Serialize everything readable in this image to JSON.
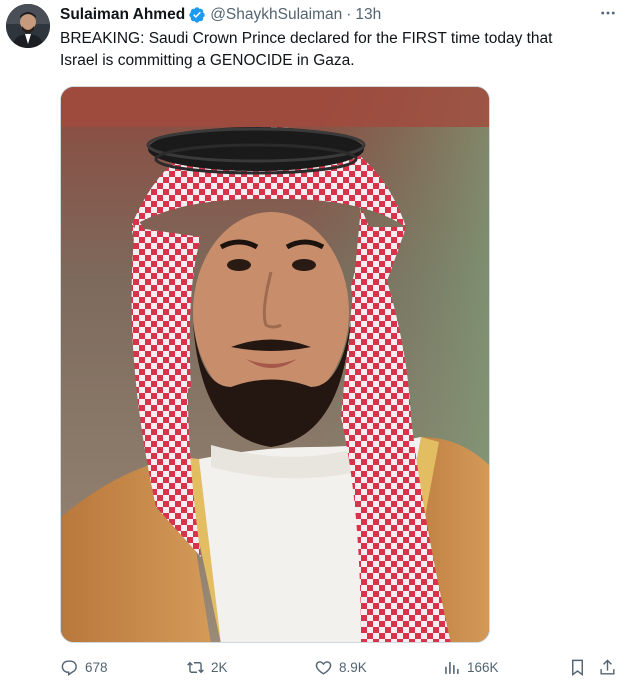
{
  "author": {
    "display_name": "Sulaiman Ahmed",
    "handle": "@ShaykhSulaiman",
    "separator": "·",
    "time": "13h",
    "verified": true
  },
  "tweet": {
    "text_line_1": "BREAKING: Saudi Crown Prince declared for the FIRST time today that",
    "text_line_2": "Israel is committing a GENOCIDE in Gaza."
  },
  "media": {
    "type": "photo"
  },
  "actions": {
    "replies": "678",
    "reposts": "2K",
    "likes": "8.9K",
    "views": "166K"
  },
  "icons": {
    "more": "more-dots-icon",
    "verified": "verified-badge-icon",
    "reply": "reply-icon",
    "repost": "repost-icon",
    "like": "heart-icon",
    "views": "views-chart-icon",
    "bookmark": "bookmark-icon",
    "share": "share-icon"
  },
  "colors": {
    "verified_blue": "#1d9bf0",
    "secondary_text": "#536471",
    "primary_text": "#0f1419"
  }
}
